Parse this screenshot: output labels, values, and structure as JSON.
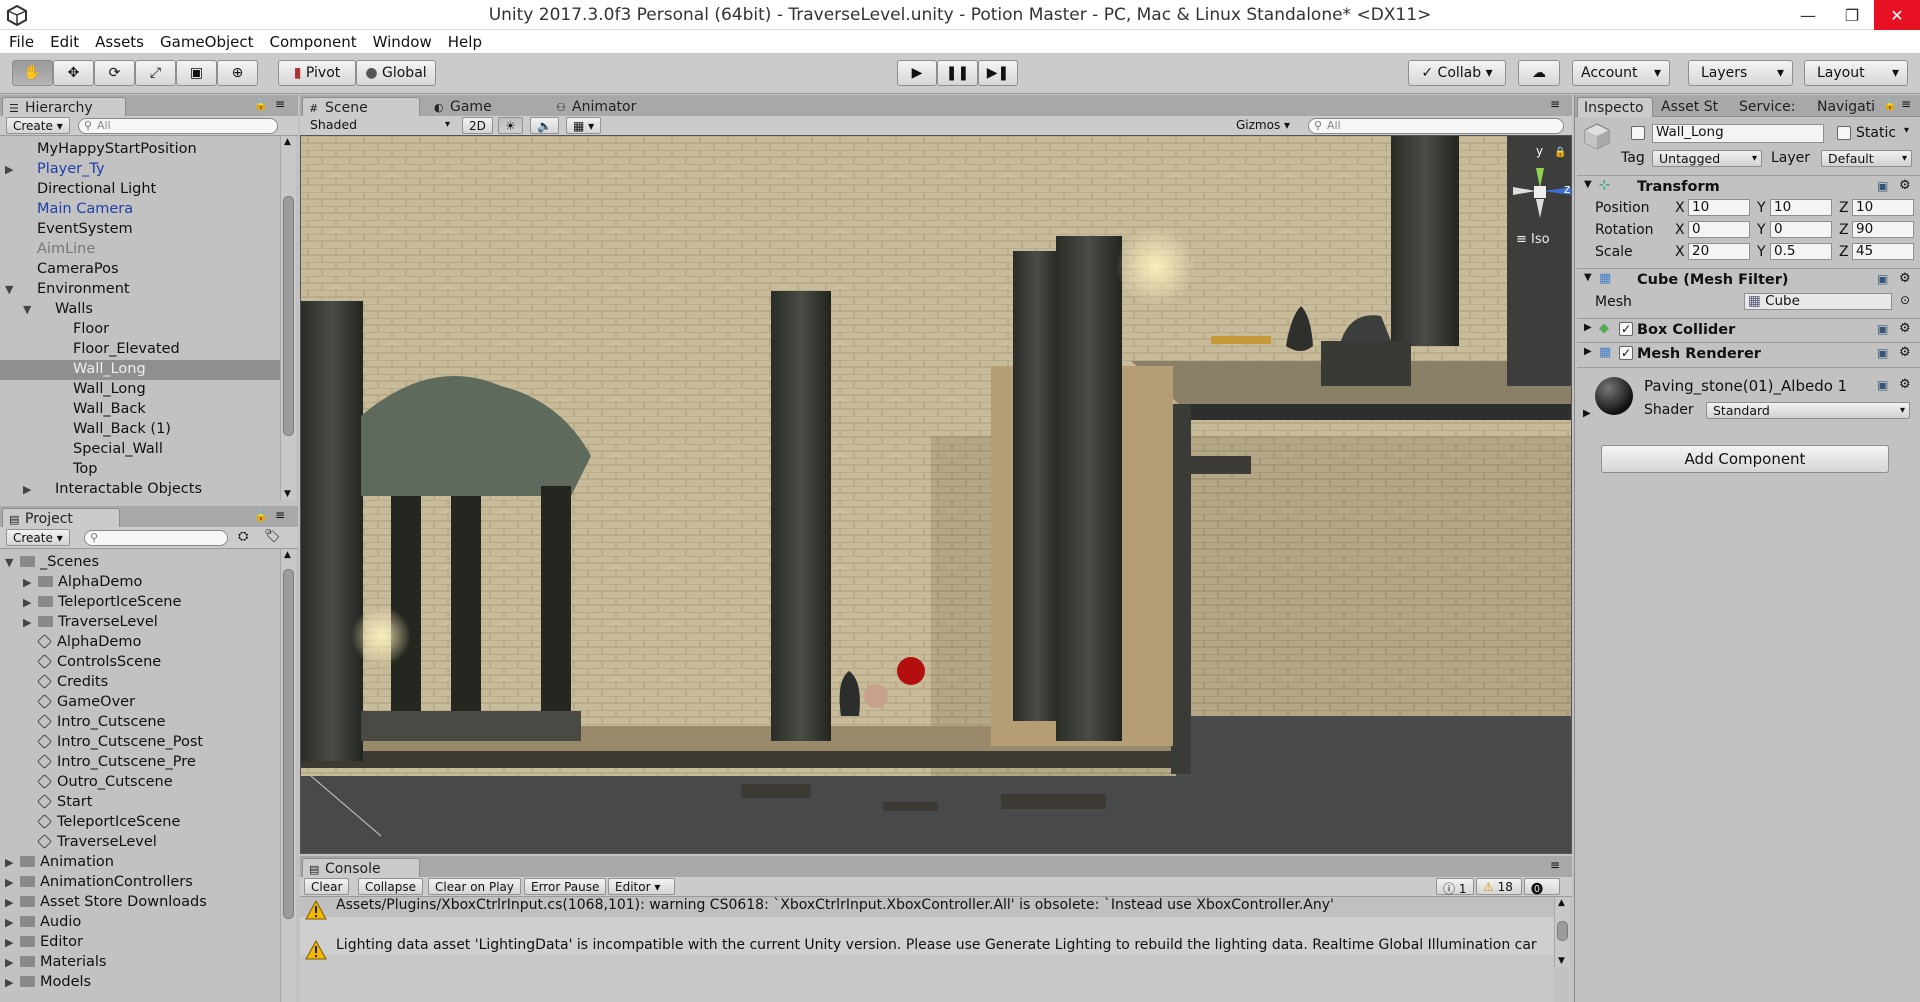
{
  "window": {
    "title": "Unity 2017.3.0f3 Personal (64bit) - TraverseLevel.unity - Potion Master - PC, Mac & Linux Standalone* <DX11>",
    "minimize": "—",
    "maximize": "❐",
    "close": "✕"
  },
  "menu": [
    "File",
    "Edit",
    "Assets",
    "GameObject",
    "Component",
    "Window",
    "Help"
  ],
  "toolbar": {
    "pivot": "Pivot",
    "global": "Global",
    "collab": "Collab",
    "account": "Account",
    "layers": "Layers",
    "layout": "Layout"
  },
  "hierarchy": {
    "tab": "Hierarchy",
    "create": "Create",
    "search_placeholder": "All",
    "items": [
      {
        "label": "MyHappyStartPosition",
        "depth": 0,
        "arrow": "",
        "color": "#111"
      },
      {
        "label": "Player_Ty",
        "depth": 0,
        "arrow": "▶",
        "color": "#1f3fa8"
      },
      {
        "label": "Directional Light",
        "depth": 0,
        "arrow": "",
        "color": "#111"
      },
      {
        "label": "Main Camera",
        "depth": 0,
        "arrow": "",
        "color": "#1f3fa8"
      },
      {
        "label": "EventSystem",
        "depth": 0,
        "arrow": "",
        "color": "#111"
      },
      {
        "label": "AimLine",
        "depth": 0,
        "arrow": "",
        "color": "#777"
      },
      {
        "label": "CameraPos",
        "depth": 0,
        "arrow": "",
        "color": "#111"
      },
      {
        "label": "Environment",
        "depth": 0,
        "arrow": "▼",
        "color": "#111"
      },
      {
        "label": "Walls",
        "depth": 1,
        "arrow": "▼",
        "color": "#111"
      },
      {
        "label": "Floor",
        "depth": 2,
        "arrow": "",
        "color": "#111"
      },
      {
        "label": "Floor_Elevated",
        "depth": 2,
        "arrow": "",
        "color": "#111"
      },
      {
        "label": "Wall_Long",
        "depth": 2,
        "arrow": "",
        "color": "#eee",
        "selected": true
      },
      {
        "label": "Wall_Long",
        "depth": 2,
        "arrow": "",
        "color": "#111"
      },
      {
        "label": "Wall_Back",
        "depth": 2,
        "arrow": "",
        "color": "#111"
      },
      {
        "label": "Wall_Back (1)",
        "depth": 2,
        "arrow": "",
        "color": "#111"
      },
      {
        "label": "Special_Wall",
        "depth": 2,
        "arrow": "",
        "color": "#111"
      },
      {
        "label": "Top",
        "depth": 2,
        "arrow": "",
        "color": "#111"
      },
      {
        "label": "Interactable Objects",
        "depth": 1,
        "arrow": "▶",
        "color": "#111"
      }
    ]
  },
  "project": {
    "tab": "Project",
    "create": "Create",
    "items": [
      {
        "label": "_Scenes",
        "depth": 0,
        "arrow": "▼",
        "kind": "folder"
      },
      {
        "label": "AlphaDemo",
        "depth": 1,
        "arrow": "▶",
        "kind": "folder"
      },
      {
        "label": "TeleportIceScene",
        "depth": 1,
        "arrow": "▶",
        "kind": "folder"
      },
      {
        "label": "TraverseLevel",
        "depth": 1,
        "arrow": "▶",
        "kind": "folder"
      },
      {
        "label": "AlphaDemo",
        "depth": 1,
        "arrow": "",
        "kind": "scene"
      },
      {
        "label": "ControlsScene",
        "depth": 1,
        "arrow": "",
        "kind": "scene"
      },
      {
        "label": "Credits",
        "depth": 1,
        "arrow": "",
        "kind": "scene"
      },
      {
        "label": "GameOver",
        "depth": 1,
        "arrow": "",
        "kind": "scene"
      },
      {
        "label": "Intro_Cutscene",
        "depth": 1,
        "arrow": "",
        "kind": "scene"
      },
      {
        "label": "Intro_Cutscene_Post",
        "depth": 1,
        "arrow": "",
        "kind": "scene"
      },
      {
        "label": "Intro_Cutscene_Pre",
        "depth": 1,
        "arrow": "",
        "kind": "scene"
      },
      {
        "label": "Outro_Cutscene",
        "depth": 1,
        "arrow": "",
        "kind": "scene"
      },
      {
        "label": "Start",
        "depth": 1,
        "arrow": "",
        "kind": "scene"
      },
      {
        "label": "TeleportIceScene",
        "depth": 1,
        "arrow": "",
        "kind": "scene"
      },
      {
        "label": "TraverseLevel",
        "depth": 1,
        "arrow": "",
        "kind": "scene"
      },
      {
        "label": "Animation",
        "depth": 0,
        "arrow": "▶",
        "kind": "folder"
      },
      {
        "label": "AnimationControllers",
        "depth": 0,
        "arrow": "▶",
        "kind": "folder"
      },
      {
        "label": "Asset Store Downloads",
        "depth": 0,
        "arrow": "▶",
        "kind": "folder"
      },
      {
        "label": "Audio",
        "depth": 0,
        "arrow": "▶",
        "kind": "folder"
      },
      {
        "label": "Editor",
        "depth": 0,
        "arrow": "▶",
        "kind": "folder"
      },
      {
        "label": "Materials",
        "depth": 0,
        "arrow": "▶",
        "kind": "folder"
      },
      {
        "label": "Models",
        "depth": 0,
        "arrow": "▶",
        "kind": "folder"
      }
    ]
  },
  "scene": {
    "tabs": [
      "Scene",
      "Game",
      "Animator"
    ],
    "shading": "Shaded",
    "mode2d": "2D",
    "gizmos": "Gizmos",
    "search_placeholder": "All",
    "iso": "Iso",
    "axis_y": "y",
    "axis_z": "z"
  },
  "console": {
    "tab": "Console",
    "buttons": [
      "Clear",
      "Collapse",
      "Clear on Play",
      "Error Pause",
      "Editor"
    ],
    "count_info": "1",
    "count_warn": "18",
    "count_error": "0",
    "lines": [
      "Assets/Plugins/XboxCtrlrInput.cs(1068,101): warning CS0618: `XboxCtrlrInput.XboxController.All' is obsolete: `Instead use XboxController.Any'",
      "Lighting data asset 'LightingData' is incompatible with the current Unity version. Please use Generate Lighting to rebuild the lighting data.  Realtime Global Illumination car"
    ]
  },
  "inspector": {
    "tabs": [
      "Inspecto",
      "Asset St",
      "Service:",
      "Navigati"
    ],
    "object_name": "Wall_Long",
    "static_label": "Static",
    "tag_label": "Tag",
    "tag_value": "Untagged",
    "layer_label": "Layer",
    "layer_value": "Default",
    "transform": {
      "title": "Transform",
      "position_label": "Position",
      "rotation_label": "Rotation",
      "scale_label": "Scale",
      "position": {
        "x": "10",
        "y": "10",
        "z": "10"
      },
      "rotation": {
        "x": "0",
        "y": "0",
        "z": "90"
      },
      "scale": {
        "x": "20",
        "y": "0.5",
        "z": "45"
      }
    },
    "axis_x": "X",
    "axis_y": "Y",
    "axis_z": "Z",
    "mesh_filter": {
      "title": "Cube (Mesh Filter)",
      "mesh_label": "Mesh",
      "mesh_value": "Cube"
    },
    "box_collider": "Box Collider",
    "mesh_renderer": "Mesh Renderer",
    "material": {
      "name": "Paving_stone(01)_Albedo 1",
      "shader_label": "Shader",
      "shader_value": "Standard"
    },
    "add_component": "Add Component"
  }
}
